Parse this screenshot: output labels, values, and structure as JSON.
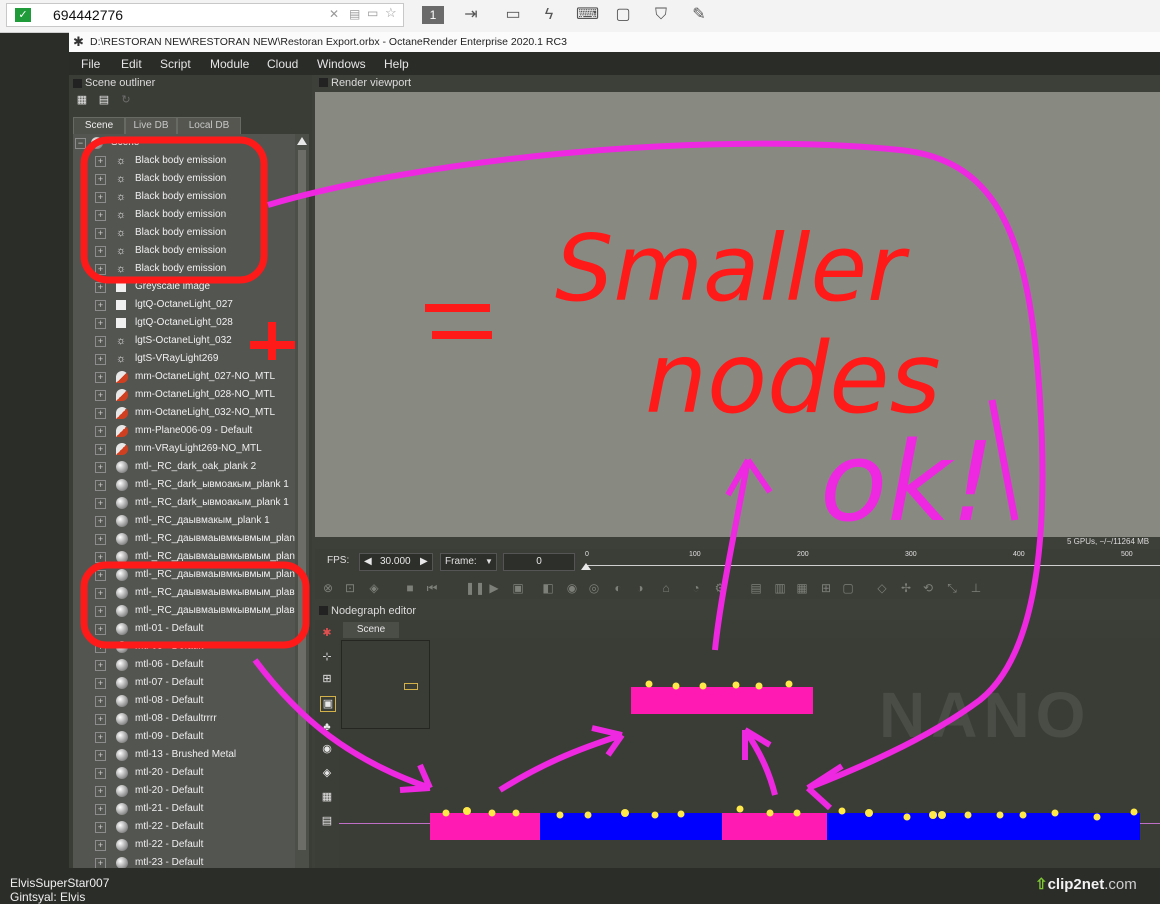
{
  "toolbar": {
    "id_value": "694442776",
    "number_button": "1",
    "icons": [
      "send-to-icon",
      "chat-icon",
      "lightning-icon",
      "keyboard-icon",
      "monitor-icon",
      "shield-icon",
      "pen-icon"
    ]
  },
  "window": {
    "title": "D:\\RESTORAN NEW\\RESTORAN NEW\\Restoran Export.orbx - OctaneRender Enterprise 2020.1 RC3"
  },
  "menu": [
    "File",
    "Edit",
    "Script",
    "Module",
    "Cloud",
    "Windows",
    "Help"
  ],
  "outliner": {
    "title": "Scene outliner",
    "tabs": [
      "Scene",
      "Live DB",
      "Local DB"
    ],
    "root": "Scene",
    "items": [
      {
        "label": "Black body emission",
        "icon": "light"
      },
      {
        "label": "Black body emission",
        "icon": "light"
      },
      {
        "label": "Black body emission",
        "icon": "light"
      },
      {
        "label": "Black body emission",
        "icon": "light"
      },
      {
        "label": "Black body emission",
        "icon": "light"
      },
      {
        "label": "Black body emission",
        "icon": "light"
      },
      {
        "label": "Black body emission",
        "icon": "light"
      },
      {
        "label": "Greyscale image",
        "icon": "img"
      },
      {
        "label": "lgtQ-OctaneLight_027",
        "icon": "img"
      },
      {
        "label": "lgtQ-OctaneLight_028",
        "icon": "img"
      },
      {
        "label": "lgtS-OctaneLight_032",
        "icon": "light"
      },
      {
        "label": "lgtS-VRayLight269",
        "icon": "light"
      },
      {
        "label": "mm-OctaneLight_027-NO_MTL",
        "icon": "mm"
      },
      {
        "label": "mm-OctaneLight_028-NO_MTL",
        "icon": "mm"
      },
      {
        "label": "mm-OctaneLight_032-NO_MTL",
        "icon": "mm"
      },
      {
        "label": "mm-Plane006-09 - Default",
        "icon": "mm"
      },
      {
        "label": "mm-VRayLight269-NO_MTL",
        "icon": "mm"
      },
      {
        "label": "mtl-_RC_dark_oak_plank 2",
        "icon": "sphere"
      },
      {
        "label": "mtl-_RC_dark_ывмоакым_plank 1",
        "icon": "sphere"
      },
      {
        "label": "mtl-_RC_dark_ывмоакым_plank 1",
        "icon": "sphere"
      },
      {
        "label": "mtl-_RC_даывмакым_plank 1",
        "icon": "sphere"
      },
      {
        "label": "mtl-_RC_даывмаывмкывмым_plank",
        "icon": "sphere"
      },
      {
        "label": "mtl-_RC_даывмаывмкывмым_plank",
        "icon": "sphere"
      },
      {
        "label": "mtl-_RC_даывмаывмкывмым_plank",
        "icon": "sphere"
      },
      {
        "label": "mtl-_RC_даывмаывмкывмым_plaвь",
        "icon": "sphere"
      },
      {
        "label": "mtl-_RC_даывмаывмкывмым_plaвь",
        "icon": "sphere"
      },
      {
        "label": "mtl-01 - Default",
        "icon": "sphere"
      },
      {
        "label": "mtl-05 - Default",
        "icon": "sphere"
      },
      {
        "label": "mtl-06 - Default",
        "icon": "sphere"
      },
      {
        "label": "mtl-07 - Default",
        "icon": "sphere"
      },
      {
        "label": "mtl-08 - Default",
        "icon": "sphere"
      },
      {
        "label": "mtl-08 - Defaultrrrr",
        "icon": "sphere"
      },
      {
        "label": "mtl-09 - Default",
        "icon": "sphere"
      },
      {
        "label": "mtl-13 - Brushed Metal",
        "icon": "sphere"
      },
      {
        "label": "mtl-20 - Default",
        "icon": "sphere"
      },
      {
        "label": "mtl-20 - Default",
        "icon": "sphere"
      },
      {
        "label": "mtl-21 - Default",
        "icon": "sphere"
      },
      {
        "label": "mtl-22 - Default",
        "icon": "sphere"
      },
      {
        "label": "mtl-22 - Default",
        "icon": "sphere"
      },
      {
        "label": "mtl-23 - Default",
        "icon": "sphere"
      }
    ]
  },
  "viewport": {
    "title": "Render viewport",
    "gpu_status": "5 GPUs, −/−/11264 MB",
    "fps_label": "FPS:",
    "fps_value": "30.000",
    "frame_label": "Frame:",
    "frame_value": "0",
    "ruler_ticks": [
      "0",
      "100",
      "200",
      "300",
      "400",
      "500"
    ]
  },
  "nodegraph": {
    "title": "Nodegraph editor",
    "tab": "Scene",
    "watermark": "NANO"
  },
  "annotation": {
    "text_eq": "=",
    "text_plus": "+",
    "text_smaller": "Smaller",
    "text_nodes": "nodes",
    "text_ok": "ok!",
    "ink_red": "#ff1a1a",
    "ink_magenta": "#ee28e0",
    "node_pink": "#ff1ab4",
    "node_blue": "#0000ff"
  },
  "status": {
    "user_line1": "ElvisSuperStar007",
    "user_line2": "Gintsyal: Elvis",
    "brand_main": "clip2net",
    "brand_domain": ".com"
  }
}
